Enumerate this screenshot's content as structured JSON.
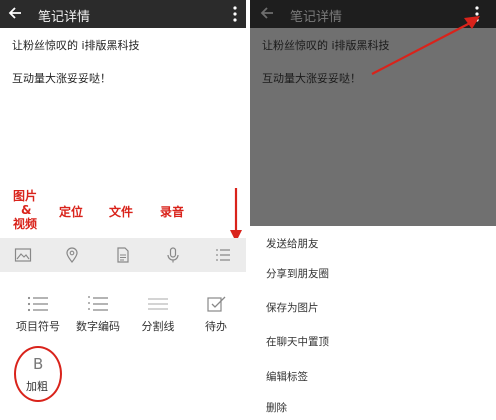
{
  "left": {
    "header": {
      "title": "笔记详情",
      "back_icon": "back-arrow-icon",
      "more_icon": "more-vertical-icon"
    },
    "note": {
      "line1": "让粉丝惊叹的 i排版黑科技",
      "line2": "互动量大涨妥妥哒！"
    },
    "annotations": {
      "image_video": [
        "图片",
        "&",
        "视频"
      ],
      "location": "定位",
      "file": "文件",
      "audio": "录音"
    },
    "toolbar": [
      "image-icon",
      "location-pin-icon",
      "file-icon",
      "microphone-icon",
      "list-icon"
    ],
    "format_options": [
      {
        "label": "项目符号",
        "icon": "bullet-list-icon"
      },
      {
        "label": "数字编码",
        "icon": "numbered-list-icon"
      },
      {
        "label": "分割线",
        "icon": "divider-line-icon"
      },
      {
        "label": "待办",
        "icon": "todo-checkbox-icon"
      }
    ],
    "bold": {
      "glyph": "B",
      "label": "加粗"
    },
    "accent_color": "#d9231b"
  },
  "right": {
    "header": {
      "title": "笔记详情"
    },
    "note": {
      "line1": "让粉丝惊叹的 i排版黑科技",
      "line2": "互动量大涨妥妥哒！"
    },
    "menu": [
      "发送给朋友",
      "分享到朋友圈",
      "保存为图片",
      "在聊天中置顶",
      "编辑标签",
      "删除"
    ]
  }
}
